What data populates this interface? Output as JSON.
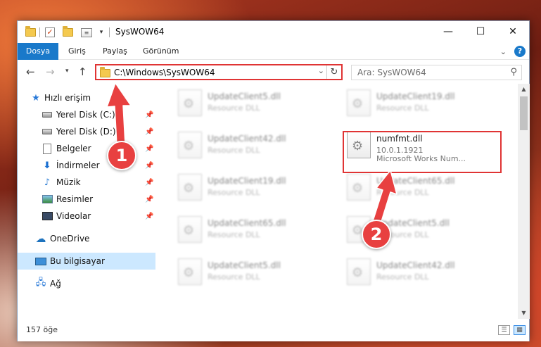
{
  "window": {
    "title": "SysWOW64",
    "controls": {
      "minimize": "—",
      "maximize": "☐",
      "close": "✕"
    }
  },
  "ribbon": {
    "tabs": [
      "Dosya",
      "Giriş",
      "Paylaş",
      "Görünüm"
    ],
    "help": "?"
  },
  "address": {
    "path": "C:\\Windows\\SysWOW64",
    "search_placeholder": "Ara: SysWOW64"
  },
  "sidebar": {
    "items": [
      {
        "label": "Hızlı erişim",
        "icon": "star-icon"
      },
      {
        "label": "Yerel Disk (C:)",
        "icon": "disk-icon",
        "pinned": true
      },
      {
        "label": "Yerel Disk (D:)",
        "icon": "disk-icon",
        "pinned": true
      },
      {
        "label": "Belgeler",
        "icon": "document-icon",
        "pinned": true
      },
      {
        "label": "İndirmeler",
        "icon": "download-icon",
        "pinned": true
      },
      {
        "label": "Müzik",
        "icon": "music-icon",
        "pinned": true
      },
      {
        "label": "Resimler",
        "icon": "pictures-icon",
        "pinned": true
      },
      {
        "label": "Videolar",
        "icon": "video-icon",
        "pinned": true
      },
      {
        "label": "OneDrive",
        "icon": "onedrive-icon"
      },
      {
        "label": "Bu bilgisayar",
        "icon": "computer-icon",
        "selected": true
      },
      {
        "label": "Ağ",
        "icon": "network-icon"
      }
    ]
  },
  "files": {
    "left": [
      {
        "name": "UpdateClient5.dll",
        "desc": "Resource DLL"
      },
      {
        "name": "UpdateClient42.dll",
        "desc": "Resource DLL"
      },
      {
        "name": "UpdateClient19.dll",
        "desc": "Resource DLL"
      },
      {
        "name": "UpdateClient65.dll",
        "desc": "Resource DLL"
      },
      {
        "name": "UpdateClient5.dll",
        "desc": "Resource DLL"
      }
    ],
    "right": [
      {
        "name": "UpdateClient19.dll",
        "desc": "Resource DLL"
      },
      {
        "name": "numfmt.dll",
        "version": "10.0.1.1921",
        "desc": "Microsoft Works Num...",
        "highlighted": true
      },
      {
        "name": "UpdateClient65.dll",
        "desc": "Resource DLL"
      },
      {
        "name": "UpdateClient5.dll",
        "desc": "Resource DLL"
      },
      {
        "name": "UpdateClient42.dll",
        "desc": "Resource DLL"
      }
    ]
  },
  "status": {
    "count": "157 öğe"
  },
  "annotations": {
    "step1": "1",
    "step2": "2"
  },
  "colors": {
    "accent": "#1979ca",
    "highlight": "#e03434",
    "selected": "#cce8ff"
  }
}
